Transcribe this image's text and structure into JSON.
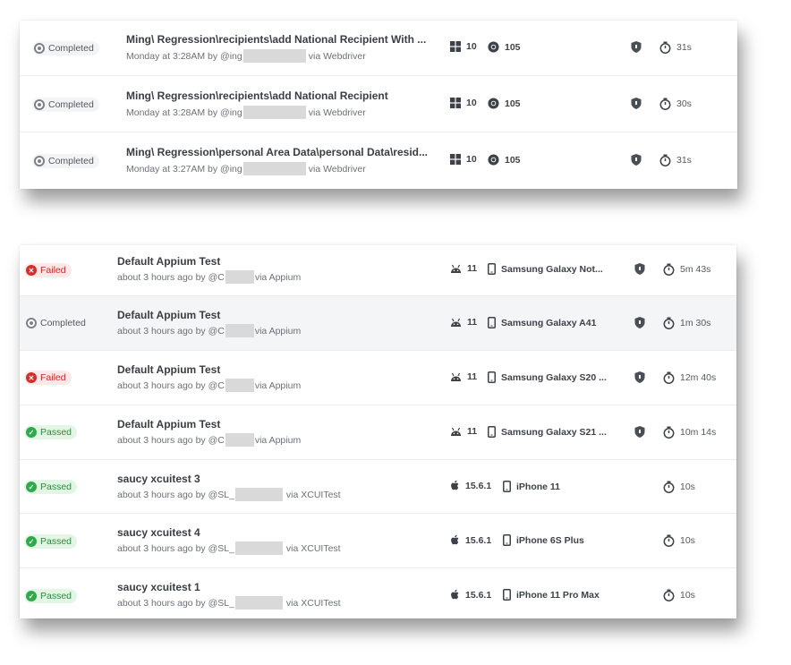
{
  "top_list": {
    "rows": [
      {
        "status": "Completed",
        "title": "Ming\\ Regression\\recipients\\add National Recipient With ...",
        "time": "Monday at 3:28AM by @ing",
        "via": "via Webdriver",
        "os_version": "10",
        "browser_version": "105",
        "duration": "31s"
      },
      {
        "status": "Completed",
        "title": "Ming\\ Regression\\recipients\\add National Recipient",
        "time": "Monday at 3:28AM by @ing",
        "via": "via Webdriver",
        "os_version": "10",
        "browser_version": "105",
        "duration": "30s"
      },
      {
        "status": "Completed",
        "title": "Ming\\ Regression\\personal Area Data\\personal Data\\resid...",
        "time": "Monday at 3:27AM by @ing",
        "via": "via Webdriver",
        "os_version": "10",
        "browser_version": "105",
        "duration": "31s"
      }
    ]
  },
  "bottom_list": {
    "rows": [
      {
        "status": "Failed",
        "title": "Default Appium Test",
        "time": "about 3 hours ago by @C",
        "via": "via Appium",
        "os_version": "11",
        "device": "Samsung Galaxy Not...",
        "duration": "5m 43s"
      },
      {
        "status": "Completed",
        "title": "Default Appium Test",
        "time": "about 3 hours ago by @C",
        "via": "via Appium",
        "os_version": "11",
        "device": "Samsung Galaxy A41",
        "duration": "1m 30s"
      },
      {
        "status": "Failed",
        "title": "Default Appium Test",
        "time": "about 3 hours ago by @C",
        "via": "via Appium",
        "os_version": "11",
        "device": "Samsung Galaxy S20 ...",
        "duration": "12m 40s"
      },
      {
        "status": "Passed",
        "title": "Default Appium Test",
        "time": "about 3 hours ago by @C",
        "via": "via Appium",
        "os_version": "11",
        "device": "Samsung Galaxy S21 ...",
        "duration": "10m 14s"
      },
      {
        "status": "Passed",
        "title": "saucy xcuitest 3",
        "time": "about 3 hours ago by @SL_",
        "via": "via XCUITest",
        "os_version": "15.6.1",
        "device": "iPhone 11",
        "duration": "10s"
      },
      {
        "status": "Passed",
        "title": "saucy xcuitest 4",
        "time": "about 3 hours ago by @SL_",
        "via": "via XCUITest",
        "os_version": "15.6.1",
        "device": "iPhone 6S Plus",
        "duration": "10s"
      },
      {
        "status": "Passed",
        "title": "saucy xcuitest 1",
        "time": "about 3 hours ago by @SL_",
        "via": "via XCUITest",
        "os_version": "15.6.1",
        "device": "iPhone 11 Pro Max",
        "duration": "10s"
      }
    ]
  },
  "colors": {
    "failed": "#d62c2c",
    "passed": "#2eaa4a",
    "completed": "#7d8187"
  },
  "icons": {
    "windows": "windows-icon",
    "chrome": "chrome-icon",
    "android": "android-icon",
    "apple": "apple-icon",
    "phone": "mobile-device-icon",
    "shield": "shield-icon",
    "timer": "stopwatch-icon",
    "failed": "x-circle-icon",
    "passed": "check-circle-icon",
    "completed": "completed-circle-icon"
  }
}
